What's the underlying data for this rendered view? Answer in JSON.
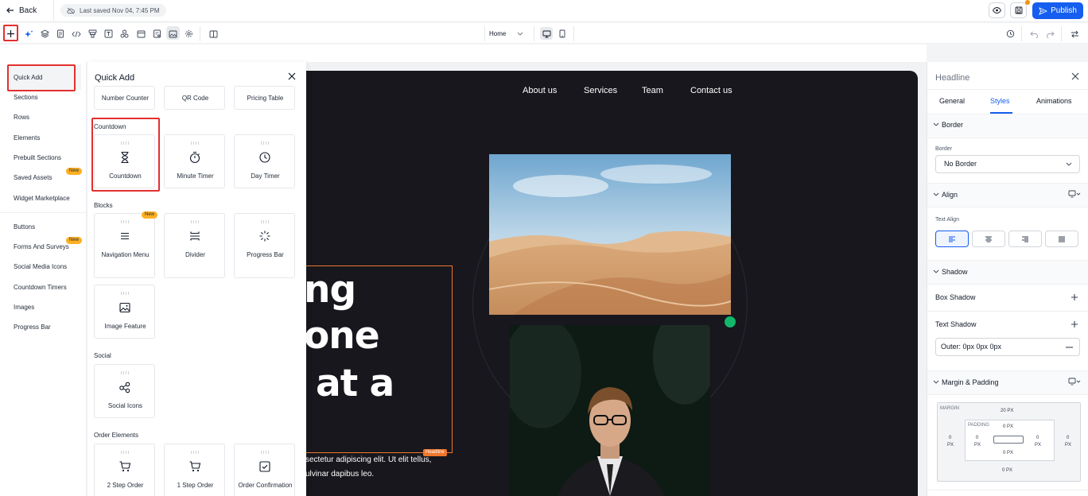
{
  "topbar": {
    "back_label": "Back",
    "saved_status": "Last saved Nov 04, 7:45 PM",
    "publish_label": "Publish"
  },
  "toolbar": {
    "page_name": "Home"
  },
  "site": {
    "nav": [
      "About us",
      "Services",
      "Team",
      "Contact us"
    ],
    "hero_lines": [
      "ng",
      "one",
      "at a"
    ],
    "headline_tag": "Headline",
    "body_lines": [
      "sectetur adipiscing elit. Ut elit tellus,",
      "ulvinar dapibus leo."
    ]
  },
  "left_nav": {
    "items": [
      "Quick Add",
      "Sections",
      "Rows",
      "Elements",
      "Prebuilt Sections",
      "Saved Assets",
      "Widget Marketplace",
      "Buttons",
      "Forms And Surveys",
      "Social Media Icons",
      "Countdown Timers",
      "Images",
      "Progress Bar"
    ],
    "badge_saved_assets": "New",
    "badge_forms": "New"
  },
  "quick_add": {
    "title": "Quick Add",
    "top_row": [
      "Number Counter",
      "QR Code",
      "Pricing Table"
    ],
    "countdown_title": "Countdown",
    "countdown_cards": [
      "Countdown",
      "Minute Timer",
      "Day Timer"
    ],
    "blocks_title": "Blocks",
    "blocks_cards": [
      "Navigation Menu",
      "Divider",
      "Progress Bar",
      "Image Feature"
    ],
    "blocks_badge": "New",
    "social_title": "Social",
    "social_cards": [
      "Social Icons"
    ],
    "order_title": "Order Elements",
    "order_cards": [
      "2 Step Order",
      "1 Step Order",
      "Order Confirmation"
    ]
  },
  "right_panel": {
    "title": "Headline",
    "tabs": [
      "General",
      "Styles",
      "Animations"
    ],
    "active_tab": "Styles",
    "border_section": "Border",
    "border_label": "Border",
    "border_value": "No Border",
    "align_section": "Align",
    "text_align_label": "Text Align",
    "shadow_section": "Shadow",
    "box_shadow_label": "Box Shadow",
    "text_shadow_label": "Text Shadow",
    "text_shadow_value": "Outer: 0px 0px 0px",
    "margin_section": "Margin & Padding",
    "box_model": {
      "margin_label": "MARGIN",
      "padding_label": "PADDING",
      "margin_top": "20 PX",
      "margin_bottom": "0 PX",
      "margin_left": "0",
      "margin_right": "0",
      "padding_top": "0 PX",
      "padding_bottom": "0 PX",
      "padding_left": "0",
      "padding_right": "0",
      "unit": "PX"
    }
  },
  "colors": {
    "accent": "#155eef",
    "highlight_red": "#e3302f",
    "selection_orange": "#f0772b",
    "badge_yellow": "#fdb022",
    "site_bg": "#17171d",
    "green_dot": "#12b76a"
  }
}
